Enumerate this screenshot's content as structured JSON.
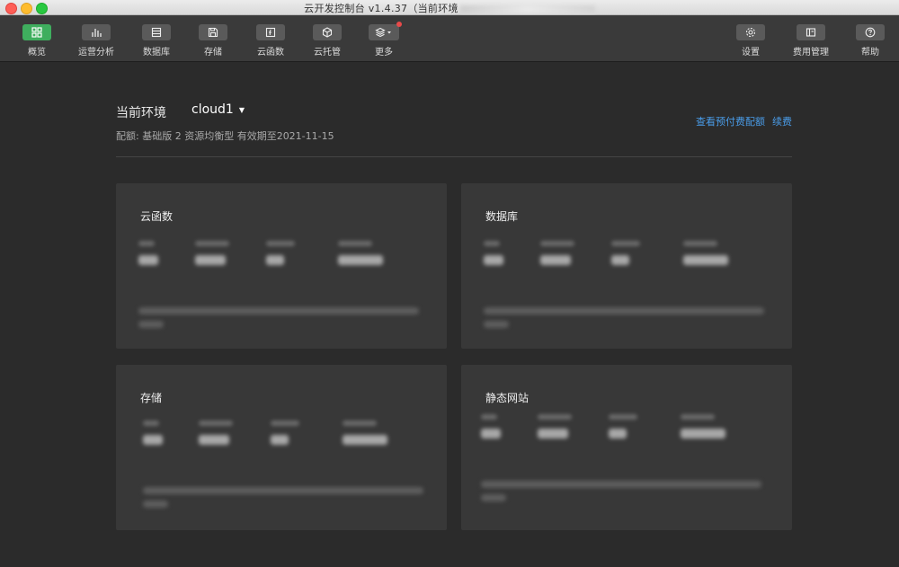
{
  "window": {
    "title": "云开发控制台 v1.4.37（当前环境"
  },
  "toolbar": {
    "left": [
      {
        "label": "概览",
        "icon": "grid-icon",
        "active": true
      },
      {
        "label": "运营分析",
        "icon": "bar-chart-icon"
      },
      {
        "label": "数据库",
        "icon": "database-icon"
      },
      {
        "label": "存储",
        "icon": "storage-icon"
      },
      {
        "label": "云函数",
        "icon": "function-icon"
      },
      {
        "label": "云托管",
        "icon": "cube-icon"
      },
      {
        "label": "更多",
        "icon": "layers-icon",
        "badge": true
      }
    ],
    "right": [
      {
        "label": "设置",
        "icon": "gear-icon"
      },
      {
        "label": "费用管理",
        "icon": "billing-icon"
      },
      {
        "label": "帮助",
        "icon": "help-icon"
      }
    ]
  },
  "env": {
    "label": "当前环境",
    "value": "cloud1",
    "quota": "配额: 基础版 2 资源均衡型  有效期至2021-11-15",
    "link_view": "查看预付费配额",
    "link_renew": "续费"
  },
  "cards": [
    {
      "title": "云函数"
    },
    {
      "title": "数据库"
    },
    {
      "title": "存储"
    },
    {
      "title": "静态网站"
    }
  ],
  "colors": {
    "accent": "#3fae5e",
    "link": "#4a9ce8",
    "badge": "#e84a4a"
  }
}
